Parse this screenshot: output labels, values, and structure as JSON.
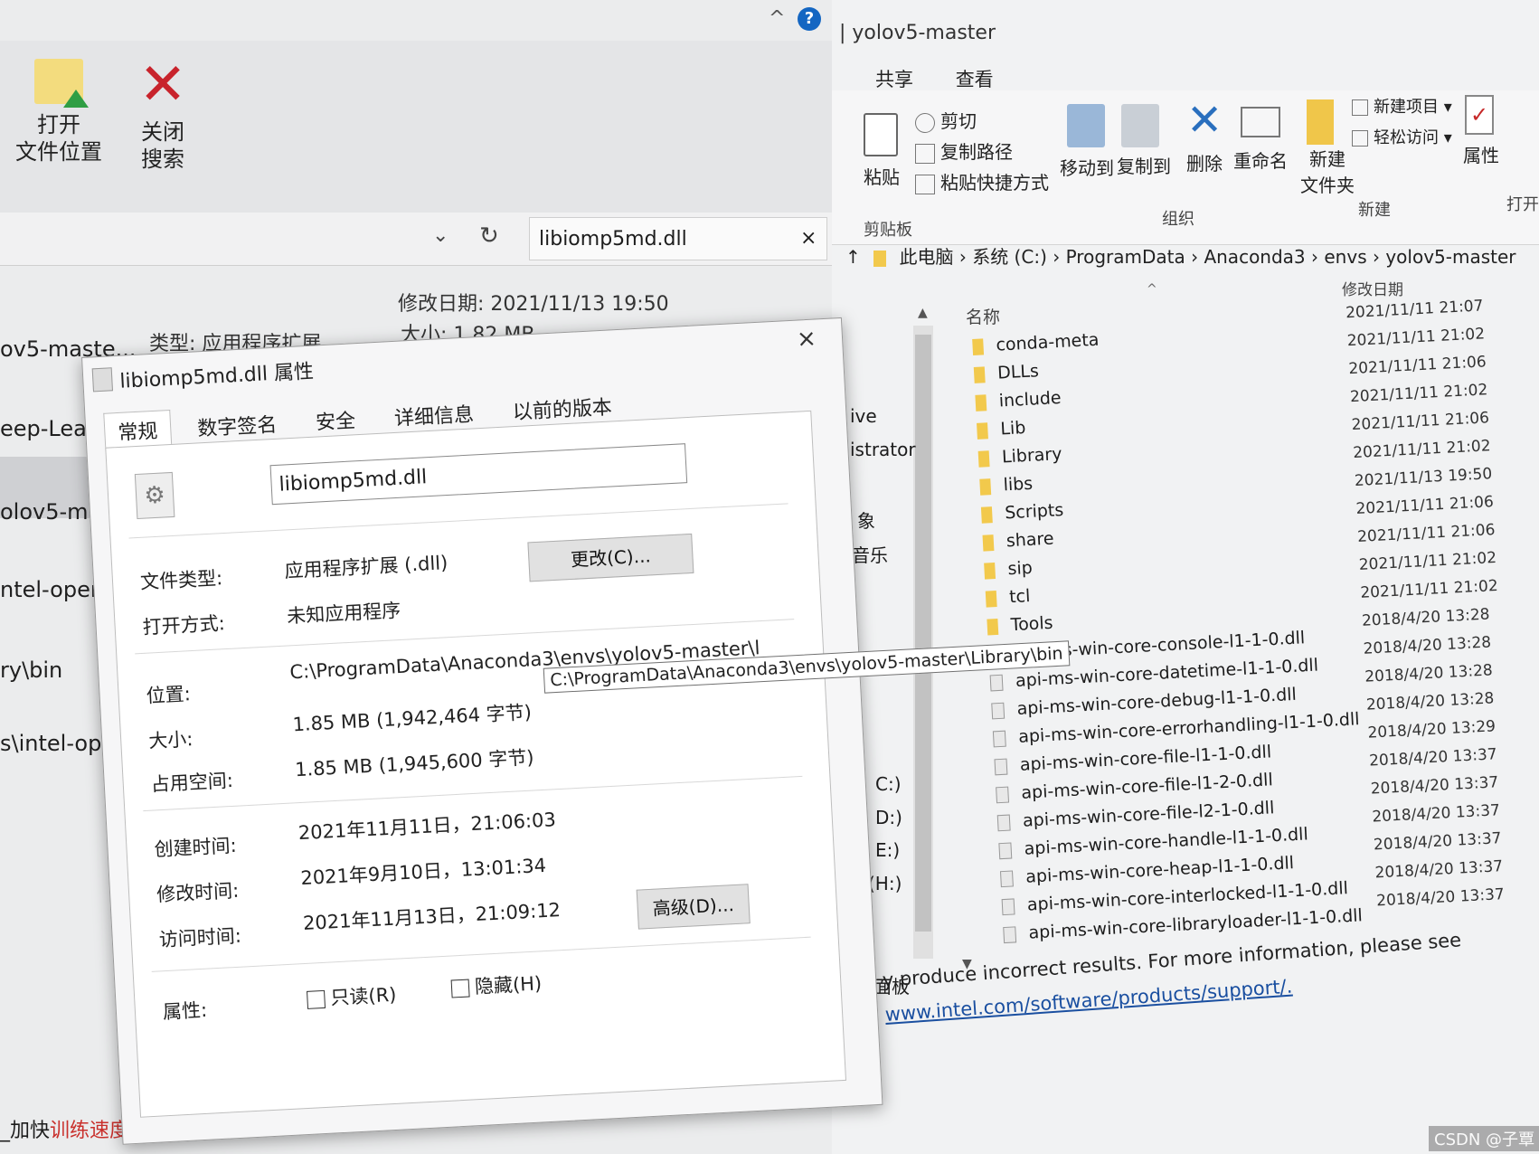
{
  "left_window": {
    "ribbon": {
      "open_location": "打开\n文件位置",
      "close_search": "关闭\n搜索"
    },
    "search_value": "libiomp5md.dll",
    "search_clear": "×",
    "chevron": "⌄",
    "refresh": "↻",
    "collapse": "^",
    "help": "?",
    "result": {
      "type": "类型: 应用程序扩展",
      "modified": "修改日期: 2021/11/13 19:50",
      "size": "大小: 1.82 MB"
    },
    "items": [
      "ov5-maste...",
      "eep-Lear",
      "olov5-ma",
      "ntel-open",
      "ry\\bin",
      "s\\intel-open"
    ],
    "bottom_text_prefix": "_加快",
    "bottom_text_red": "训练速度",
    "bottom_text_suffix": " 本"
  },
  "explorer": {
    "title": "| yolov5-master",
    "tabs": [
      "共享",
      "查看"
    ],
    "clipboard": {
      "paste": "粘贴",
      "cut": "剪切",
      "copy_path": "复制路径",
      "paste_shortcut": "粘贴快捷方式",
      "group": "剪贴板"
    },
    "organize": {
      "move_to": "移动到",
      "copy_to": "复制到",
      "delete": "删除",
      "rename": "重命名",
      "group": "组织"
    },
    "new": {
      "new_folder": "新建\n文件夹",
      "new_item": "新建项目 ▾",
      "easy_access": "轻松访问 ▾",
      "group": "新建"
    },
    "open": {
      "properties": "属性",
      "group": "打开"
    },
    "breadcrumb": [
      "此电脑",
      "系统 (C:)",
      "ProgramData",
      "Anaconda3",
      "envs",
      "yolov5-master"
    ],
    "col_name": "名称",
    "col_date": "修改日期",
    "nav_pane": [
      "ive",
      "istrator",
      "象",
      "音乐",
      "C:)",
      "D:)",
      "E:)",
      "(H:)",
      "面板"
    ],
    "files": [
      {
        "name": "conda-meta",
        "kind": "folder",
        "date": "2021/11/11 21:07"
      },
      {
        "name": "DLLs",
        "kind": "folder",
        "date": "2021/11/11 21:02"
      },
      {
        "name": "include",
        "kind": "folder",
        "date": "2021/11/11 21:06"
      },
      {
        "name": "Lib",
        "kind": "folder",
        "date": "2021/11/11 21:02"
      },
      {
        "name": "Library",
        "kind": "folder",
        "date": "2021/11/11 21:06"
      },
      {
        "name": "libs",
        "kind": "folder",
        "date": "2021/11/11 21:02"
      },
      {
        "name": "Scripts",
        "kind": "folder",
        "date": "2021/11/13 19:50"
      },
      {
        "name": "share",
        "kind": "folder",
        "date": "2021/11/11 21:06"
      },
      {
        "name": "sip",
        "kind": "folder",
        "date": "2021/11/11 21:06"
      },
      {
        "name": "tcl",
        "kind": "folder",
        "date": "2021/11/11 21:02"
      },
      {
        "name": "Tools",
        "kind": "folder",
        "date": "2021/11/11 21:02"
      },
      {
        "name": "api-ms-win-core-console-l1-1-0.dll",
        "kind": "dll",
        "date": "2018/4/20 13:28"
      },
      {
        "name": "api-ms-win-core-datetime-l1-1-0.dll",
        "kind": "dll",
        "date": "2018/4/20 13:28"
      },
      {
        "name": "api-ms-win-core-debug-l1-1-0.dll",
        "kind": "dll",
        "date": "2018/4/20 13:28"
      },
      {
        "name": "api-ms-win-core-errorhandling-l1-1-0.dll",
        "kind": "dll",
        "date": "2018/4/20 13:28"
      },
      {
        "name": "api-ms-win-core-file-l1-1-0.dll",
        "kind": "dll",
        "date": "2018/4/20 13:29"
      },
      {
        "name": "api-ms-win-core-file-l1-2-0.dll",
        "kind": "dll",
        "date": "2018/4/20 13:37"
      },
      {
        "name": "api-ms-win-core-file-l2-1-0.dll",
        "kind": "dll",
        "date": "2018/4/20 13:37"
      },
      {
        "name": "api-ms-win-core-handle-l1-1-0.dll",
        "kind": "dll",
        "date": "2018/4/20 13:37"
      },
      {
        "name": "api-ms-win-core-heap-l1-1-0.dll",
        "kind": "dll",
        "date": "2018/4/20 13:37"
      },
      {
        "name": "api-ms-win-core-interlocked-l1-1-0.dll",
        "kind": "dll",
        "date": "2018/4/20 13:37"
      },
      {
        "name": "api-ms-win-core-libraryloader-l1-1-0.dll",
        "kind": "dll",
        "date": "2018/4/20 13:37"
      }
    ],
    "console_text": "y produce incorrect results. For more information, please see",
    "console_link": "www.intel.com/software/products/support/."
  },
  "dialog": {
    "title": "libiomp5md.dll 属性",
    "close": "×",
    "tabs": [
      "常规",
      "数字签名",
      "安全",
      "详细信息",
      "以前的版本"
    ],
    "file_name": "libiomp5md.dll",
    "file_type_label": "文件类型:",
    "file_type_value": "应用程序扩展 (.dll)",
    "open_with_label": "打开方式:",
    "open_with_value": "未知应用程序",
    "change_button": "更改(C)...",
    "location_label": "位置:",
    "location_value": "C:\\ProgramData\\Anaconda3\\envs\\yolov5-master\\l",
    "tooltip": "C:\\ProgramData\\Anaconda3\\envs\\yolov5-master\\Library\\bin",
    "size_label": "大小:",
    "size_value": "1.85 MB (1,942,464 字节)",
    "disk_label": "占用空间:",
    "disk_value": "1.85 MB (1,945,600 字节)",
    "created_label": "创建时间:",
    "created_value": "2021年11月11日，21:06:03",
    "modified_label": "修改时间:",
    "modified_value": "2021年9月10日，13:01:34",
    "accessed_label": "访问时间:",
    "accessed_value": "2021年11月13日，21:09:12",
    "attributes_label": "属性:",
    "readonly": "只读(R)",
    "hidden": "隐藏(H)",
    "advanced_button": "高级(D)..."
  },
  "watermark": "CSDN @子覃"
}
